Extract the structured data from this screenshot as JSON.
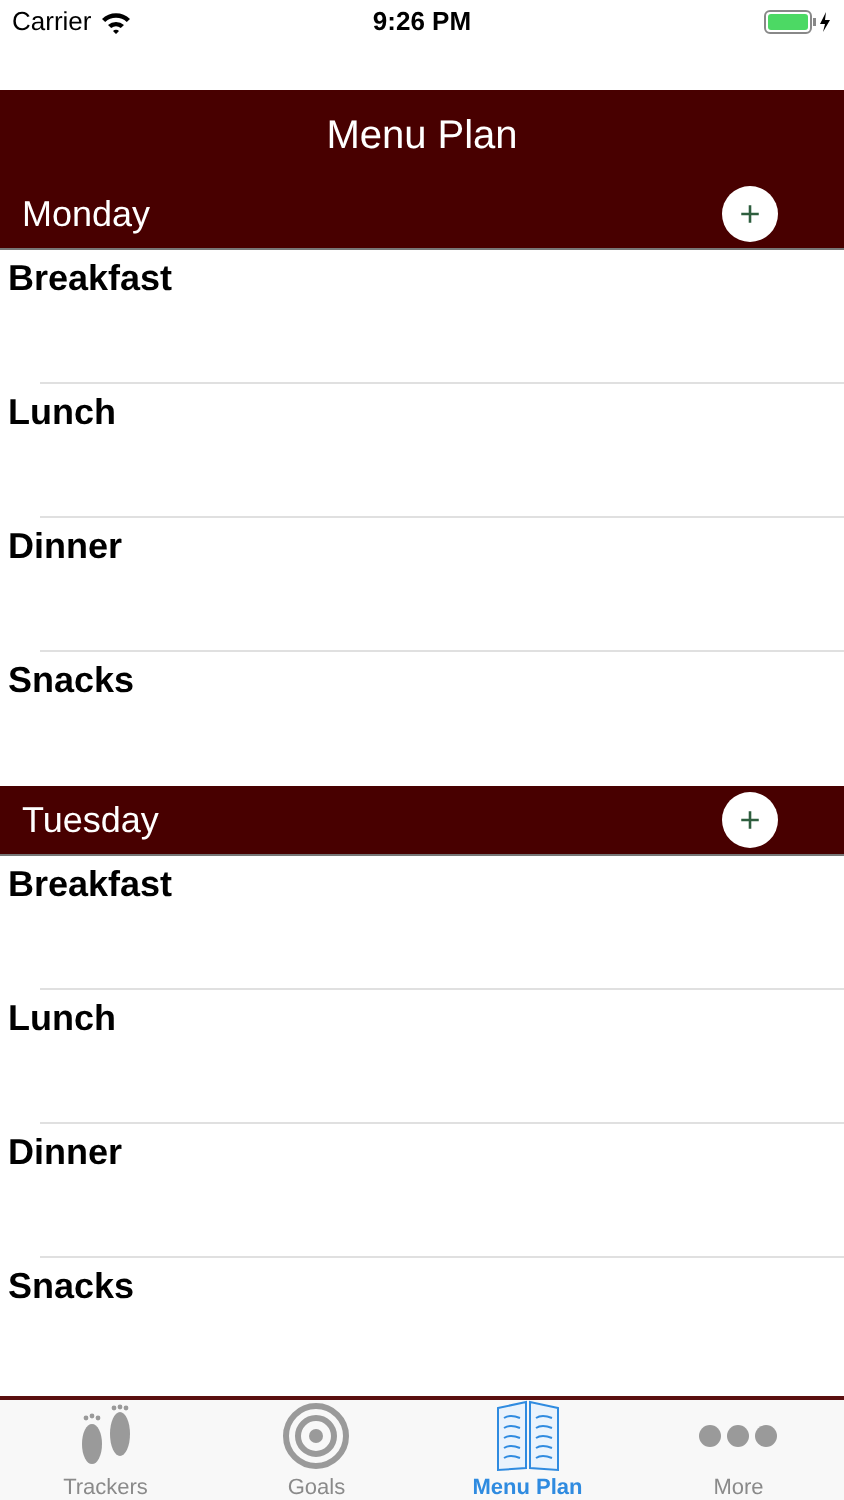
{
  "status_bar": {
    "carrier": "Carrier",
    "time": "9:26 PM"
  },
  "nav": {
    "title": "Menu Plan"
  },
  "days": [
    {
      "name": "Monday",
      "add_button": "+",
      "meals": [
        "Breakfast",
        "Lunch",
        "Dinner",
        "Snacks"
      ]
    },
    {
      "name": "Tuesday",
      "add_button": "+",
      "meals": [
        "Breakfast",
        "Lunch",
        "Dinner",
        "Snacks"
      ]
    }
  ],
  "tabs": [
    {
      "label": "Trackers",
      "kind": "feet",
      "selected": false
    },
    {
      "label": "Goals",
      "kind": "target",
      "selected": false
    },
    {
      "label": "Menu Plan",
      "kind": "menu",
      "selected": true
    },
    {
      "label": "More",
      "kind": "more",
      "selected": false
    }
  ]
}
